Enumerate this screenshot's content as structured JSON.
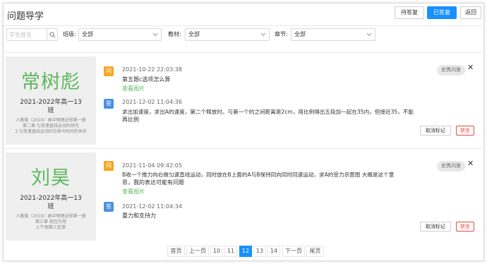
{
  "header": {
    "title": "问题导学",
    "buttons": {
      "pending": "待答复",
      "replied": "已答复",
      "back": "返回"
    }
  },
  "filters": {
    "search_placeholder": "学生姓名",
    "class_label": "班级:",
    "class_value": "全部",
    "textbook_label": "教材:",
    "textbook_value": "全部",
    "chapter_label": "章节:",
    "chapter_value": "全部"
  },
  "cards": [
    {
      "student": {
        "name": "常树彪",
        "class_line1": "2021-2022年高一13",
        "class_line2": "班",
        "book_line1": "人教版（2019）高中物理必修第一册",
        "book_line2": "第二章 匀变速直线运动的研究",
        "book_line3": "3.匀变速直线运动的位移与时间的关系"
      },
      "question": {
        "badge": "问",
        "time": "2021-10-22 22:03:38",
        "text": "第五题c选项怎么算",
        "link": "查看图片"
      },
      "answer": {
        "badge": "答",
        "time": "2021-12-02 11:04:36",
        "text_line1": "求出加速度，求出A的速度，第二个释放时。与第一个的之间距离是2cm，用比例得出五段加一起在35内，但接近35，不能",
        "text_line2": "再比例"
      },
      "excellent": "优秀问答",
      "cancel_mark": "取消标记",
      "ban": "禁言"
    },
    {
      "student": {
        "name": "刘昊",
        "class_line1": "2021-2022年高一13",
        "class_line2": "班",
        "book_line1": "人教版（2019）高中物理必修第一册",
        "book_line2": "第三章 相互作用",
        "book_line3": "3.牛顿第三定律"
      },
      "question": {
        "badge": "问",
        "time": "2021-11-04 09:42:05",
        "text_line1": "B收一个推力向右做匀速直线运动，同时放在B上面的A与B保持同向同时同速运动，求A的受力示意图 大概是这个意",
        "text_line2": "思，我的表达可能有问题",
        "link": "查看图片"
      },
      "answer": {
        "badge": "答",
        "time": "2021-12-02 11:04:34",
        "text": "重力和支持力"
      },
      "excellent": "优秀问答",
      "cancel_mark": "取消标记",
      "ban": "禁言"
    }
  ],
  "pagination": {
    "first": "首页",
    "prev": "上一页",
    "pages": [
      "10",
      "11",
      "12",
      "13",
      "14"
    ],
    "current": "12",
    "next": "下一页",
    "last": "尾页"
  },
  "colors": {
    "primary": "#1890ff",
    "green": "#5cb85c",
    "question": "#f5a623",
    "answer": "#4a90e2",
    "danger": "#e74c3c"
  },
  "icons": {
    "search": "search-icon",
    "dropdown": "chevron-down-icon",
    "close": "close-icon"
  }
}
